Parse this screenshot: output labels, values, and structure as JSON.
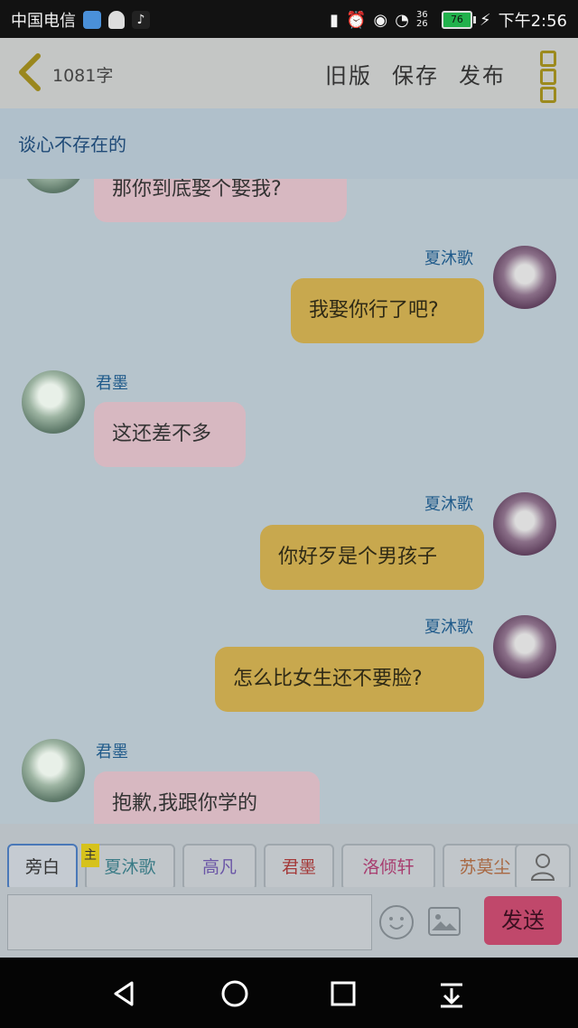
{
  "status_bar": {
    "carrier": "中国电信",
    "network": "36 26",
    "battery": "76",
    "time": "下午2:56"
  },
  "header": {
    "word_count": "1081字",
    "actions": [
      "旧版",
      "保存",
      "发布"
    ]
  },
  "chat": {
    "title": "谈心不存在的",
    "messages": [
      {
        "side": "left",
        "name": "",
        "text": "那你到底娶个娶我?"
      },
      {
        "side": "right",
        "name": "夏沐歌",
        "text": "我娶你行了吧?"
      },
      {
        "side": "left",
        "name": "君墨",
        "text": "这还差不多"
      },
      {
        "side": "right",
        "name": "夏沐歌",
        "text": "你好歹是个男孩子"
      },
      {
        "side": "right",
        "name": "夏沐歌",
        "text": "怎么比女生还不要脸?"
      },
      {
        "side": "left",
        "name": "君墨",
        "text": "抱歉,我跟你学的"
      }
    ]
  },
  "role_selector": {
    "items": [
      "旁白",
      "夏沐歌",
      "高凡",
      "君墨",
      "洛倾轩",
      "苏莫尘"
    ],
    "main_tag": "主",
    "colors": [
      "#333333",
      "#3a7b86",
      "#6a55a6",
      "#a43a3a",
      "#a83d6f",
      "#a86842"
    ]
  },
  "composer": {
    "placeholder": "",
    "send_label": "发送"
  }
}
